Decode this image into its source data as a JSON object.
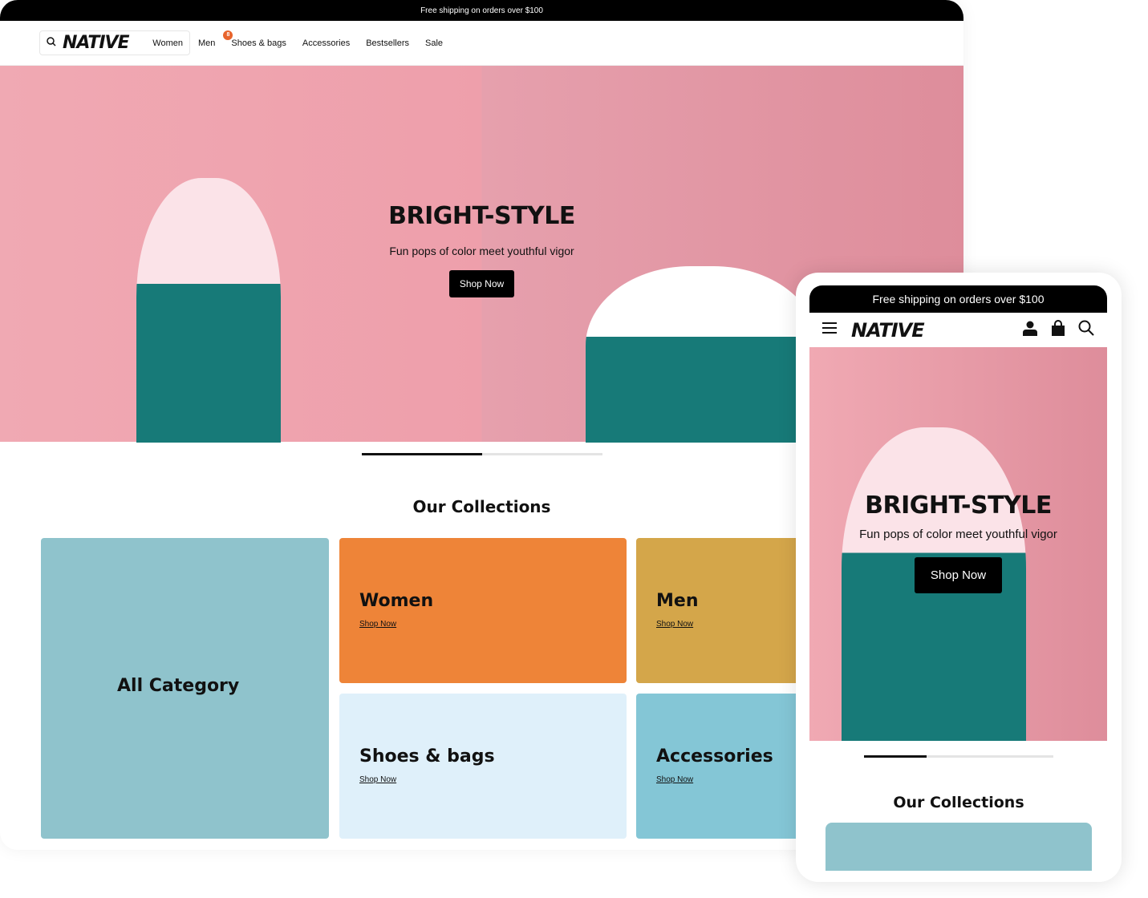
{
  "desktop": {
    "topbar": "Free shipping on orders over $100",
    "logo": "NATIVE",
    "nav": [
      "Women",
      "Men",
      "Shoes & bags",
      "Accessories",
      "Bestsellers",
      "Sale"
    ],
    "cart_count": "8",
    "hero": {
      "title": "BRIGHT-STYLE",
      "subtitle": "Fun pops of color meet youthful vigor",
      "button": "Shop Now"
    },
    "slider_progress": 0.5,
    "collections_title": "Our Collections",
    "collections": [
      {
        "title": "All Category",
        "color": "#8fc3cc"
      },
      {
        "title": "Women",
        "link": "Shop Now",
        "color": "#ee8438"
      },
      {
        "title": "Men",
        "link": "Shop Now",
        "color": "#d4a64a"
      },
      {
        "title": "Shoes & bags",
        "link": "Shop Now",
        "color": "#dff0fa"
      },
      {
        "title": "Accessories",
        "link": "Shop Now",
        "color": "#84c6d6"
      }
    ]
  },
  "mobile": {
    "topbar": "Free shipping on orders over $100",
    "logo": "NATIVE",
    "hero": {
      "title": "BRIGHT-STYLE",
      "subtitle": "Fun pops of color meet youthful vigor",
      "button": "Shop Now"
    },
    "slider_progress": 0.33,
    "collections_title": "Our Collections"
  }
}
